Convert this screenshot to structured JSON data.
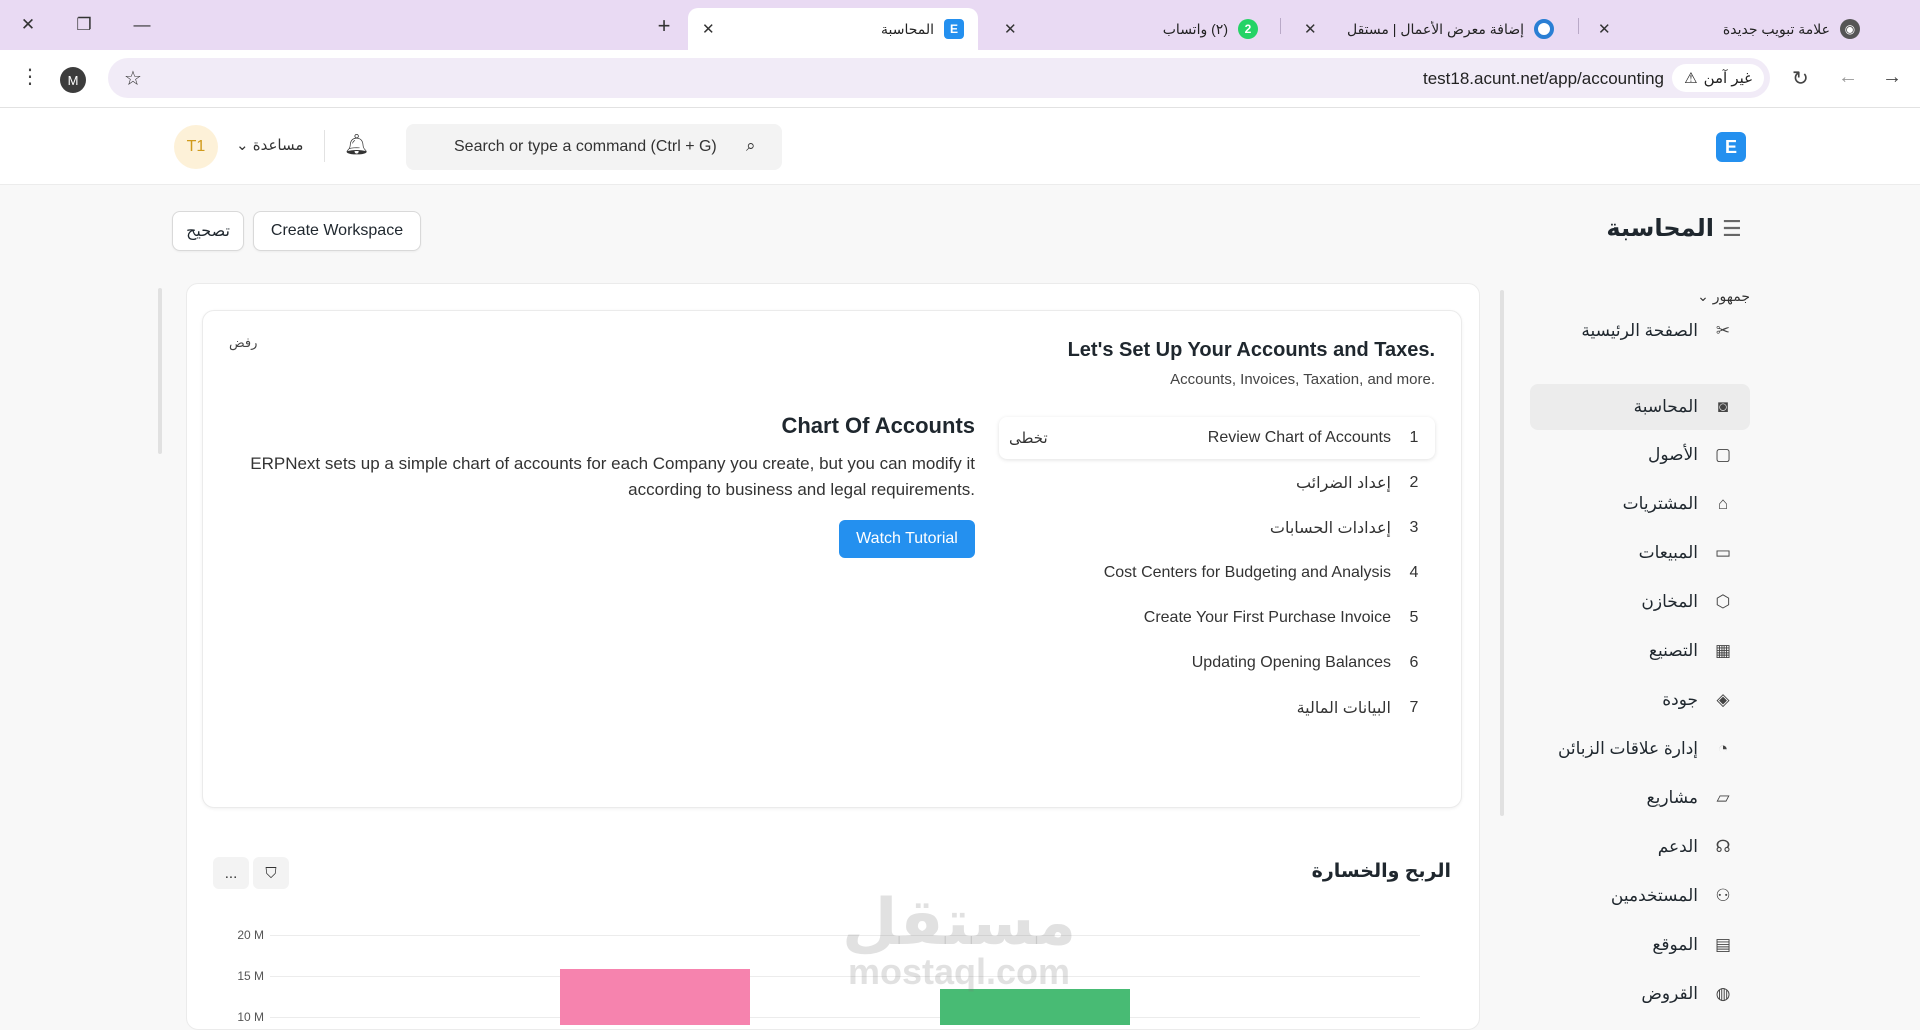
{
  "browser": {
    "tabs": [
      {
        "title": "علامة تبويب جديدة",
        "icon": "chrome-icon"
      },
      {
        "title": "إضافة معرض الأعمال | مستقل",
        "icon": "mostaql-icon"
      },
      {
        "title": "(٢) واتساب",
        "badge": "2",
        "icon": "whatsapp-icon"
      },
      {
        "title": "المحاسبة",
        "icon": "erpnext-icon",
        "icon_letter": "E",
        "active": true
      }
    ],
    "url": "test18.acunt.net/app/accounting",
    "security_label": "غير آمن",
    "profile_letter": "M"
  },
  "navbar": {
    "logo_letter": "E",
    "search_placeholder": "Search or type a command (Ctrl + G)",
    "help_label": "مساعدة",
    "avatar_initials": "T1"
  },
  "page": {
    "title": "المحاسبة",
    "create_workspace_label": "Create Workspace",
    "edit_label": "تصحيح"
  },
  "sidebar": {
    "section_label": "جمهور",
    "items": [
      {
        "label": "الصفحة الرئيسية",
        "icon": "tools-icon"
      },
      {
        "label": "المحاسبة",
        "icon": "accounting-icon",
        "active": true
      },
      {
        "label": "الأصول",
        "icon": "assets-icon"
      },
      {
        "label": "المشتريات",
        "icon": "buying-icon"
      },
      {
        "label": "المبيعات",
        "icon": "selling-icon"
      },
      {
        "label": "المخازن",
        "icon": "stock-icon"
      },
      {
        "label": "التصنيع",
        "icon": "manufacturing-icon"
      },
      {
        "label": "جودة",
        "icon": "quality-icon"
      },
      {
        "label": "إدارة علاقات الزبائن",
        "icon": "crm-icon"
      },
      {
        "label": "مشاريع",
        "icon": "projects-icon"
      },
      {
        "label": "الدعم",
        "icon": "support-icon"
      },
      {
        "label": "المستخدمين",
        "icon": "users-icon"
      },
      {
        "label": "الموقع",
        "icon": "website-icon"
      },
      {
        "label": "القروض",
        "icon": "loans-icon"
      }
    ]
  },
  "onboarding": {
    "title": "Let's Set Up Your Accounts and Taxes.",
    "subtitle": "Accounts, Invoices, Taxation, and more.",
    "dismiss_label": "رفض",
    "skip_label": "تخطى",
    "steps": [
      {
        "num": "1",
        "label": "Review Chart of Accounts",
        "active": true
      },
      {
        "num": "2",
        "label": "إعداد الضرائب"
      },
      {
        "num": "3",
        "label": "إعدادات الحسابات"
      },
      {
        "num": "4",
        "label": "Cost Centers for Budgeting and Analysis"
      },
      {
        "num": "5",
        "label": "Create Your First Purchase Invoice"
      },
      {
        "num": "6",
        "label": "Updating Opening Balances"
      },
      {
        "num": "7",
        "label": "البيانات المالية"
      }
    ],
    "detail": {
      "title": "Chart Of Accounts",
      "description": "ERPNext sets up a simple chart of accounts for each Company you create, but you can modify it according to business and legal requirements.",
      "button_label": "Watch Tutorial"
    }
  },
  "profit_loss": {
    "title": "الربح والخسارة",
    "more_label": "..."
  },
  "watermark": {
    "line1": "مستقل",
    "line2": "mostaql.com"
  },
  "chart_data": {
    "type": "bar",
    "y_ticks": [
      "20 M",
      "15 M",
      "10 M"
    ],
    "ylim": [
      10,
      20
    ],
    "series": [
      {
        "color": "#f683ae",
        "values": [
          15.9
        ]
      },
      {
        "color": "#48bb74",
        "values": [
          13.4
        ]
      }
    ]
  },
  "colors": {
    "accent": "#2490ef",
    "tabbar": "#e9daf3",
    "income_bar": "#f683ae",
    "expense_bar": "#48bb74"
  }
}
